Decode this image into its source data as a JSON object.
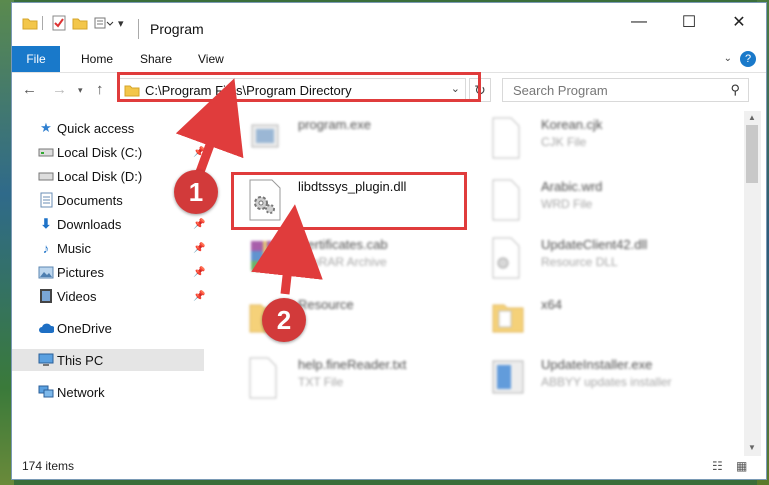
{
  "window": {
    "title": "Program",
    "minimize": "—",
    "maximize": "☐",
    "close": "✕"
  },
  "ribbon": {
    "tabs": [
      "File",
      "Home",
      "Share",
      "View"
    ],
    "help": "?"
  },
  "address_bar": {
    "path": "C:\\Program Files\\Program Directory",
    "search_placeholder": "Search Program"
  },
  "nav_pane": {
    "items": [
      {
        "label": "Quick access",
        "icon": "star-icon",
        "pinned": false
      },
      {
        "label": "Local Disk (C:)",
        "icon": "drive-icon",
        "pinned": true
      },
      {
        "label": "Local Disk (D:)",
        "icon": "drive-icon",
        "pinned": false
      },
      {
        "label": "Documents",
        "icon": "documents-icon",
        "pinned": true
      },
      {
        "label": "Downloads",
        "icon": "download-icon",
        "pinned": true
      },
      {
        "label": "Music",
        "icon": "music-icon",
        "pinned": true
      },
      {
        "label": "Pictures",
        "icon": "pictures-icon",
        "pinned": true
      },
      {
        "label": "Videos",
        "icon": "videos-icon",
        "pinned": true
      },
      {
        "label": "OneDrive",
        "icon": "cloud-icon",
        "pinned": false
      },
      {
        "label": "This PC",
        "icon": "computer-icon",
        "pinned": false,
        "selected": true
      },
      {
        "label": "Network",
        "icon": "network-icon",
        "pinned": false
      }
    ]
  },
  "files": [
    {
      "name": "program.exe",
      "type": "",
      "icon": "exe-icon"
    },
    {
      "name": "Korean.cjk",
      "type": "CJK File",
      "icon": "blank-file-icon"
    },
    {
      "name": "libdtssys_plugin.dll",
      "type": "",
      "icon": "dll-gear-icon",
      "highlighted": true
    },
    {
      "name": "Arabic.wrd",
      "type": "WRD File",
      "icon": "blank-file-icon"
    },
    {
      "name": "Certificates.cab",
      "type": "WinRAR Archive",
      "icon": "winrar-icon"
    },
    {
      "name": "UpdateClient42.dll",
      "type": "Resource DLL",
      "icon": "dll-gear-icon"
    },
    {
      "name": "Resource",
      "type": "",
      "icon": "folder-icon"
    },
    {
      "name": "x64",
      "type": "",
      "icon": "folder-icon"
    },
    {
      "name": "help.fineReader.txt",
      "type": "TXT File",
      "icon": "text-file-icon"
    },
    {
      "name": "UpdateInstaller.exe",
      "type": "ABBYY updates installer",
      "icon": "installer-icon"
    }
  ],
  "status": {
    "item_count": "174 items"
  },
  "annotations": {
    "step1": "1",
    "step2": "2",
    "highlight_color": "#e03c3c"
  }
}
